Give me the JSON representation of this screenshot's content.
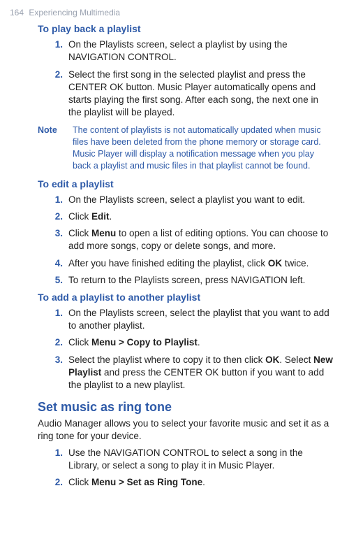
{
  "header": {
    "page": "164",
    "chapter": "Experiencing Multimedia"
  },
  "sec_play": {
    "title": "To play back a playlist",
    "items": [
      {
        "n": "1.",
        "t": "On the Playlists screen, select a playlist by using the NAVIGATION CONTROL."
      },
      {
        "n": "2.",
        "t": "Select the first song in the selected playlist and press the CENTER OK button. Music Player automatically opens and starts playing the first song. After each song, the next one in the playlist will be played."
      }
    ],
    "note_label": "Note",
    "note_body": "The content of playlists is not automatically updated when music files have been deleted from the phone memory or storage card. Music Player will display a notification message when you play back a playlist and music files in that playlist cannot be found."
  },
  "sec_edit": {
    "title": "To edit a playlist",
    "items": [
      {
        "n": "1.",
        "t": "On the Playlists screen, select a playlist you want to edit."
      },
      {
        "n": "2.",
        "pre": "Click ",
        "b1": "Edit",
        "post": "."
      },
      {
        "n": "3.",
        "pre": "Click ",
        "b1": "Menu",
        "post": " to open a list of editing options. You can choose to add more songs, copy or delete songs, and more."
      },
      {
        "n": "4.",
        "pre": "After you have finished editing the playlist, click ",
        "b1": "OK",
        "post": " twice."
      },
      {
        "n": "5.",
        "t": "To return to the Playlists screen, press NAVIGATION left."
      }
    ]
  },
  "sec_add": {
    "title": "To add a playlist to another playlist",
    "items": [
      {
        "n": "1.",
        "t": "On the Playlists screen, select the playlist that you want to add to another playlist."
      },
      {
        "n": "2.",
        "pre": "Click ",
        "b1": "Menu > Copy to Playlist",
        "post": "."
      },
      {
        "n": "3.",
        "pre": "Select the playlist where to copy it to then click ",
        "b1": "OK",
        "mid": ". Select ",
        "b2": "New Playlist",
        "post": " and press the CENTER OK button if you want to add the playlist to a new playlist."
      }
    ]
  },
  "sec_ring": {
    "title": "Set music as ring tone",
    "intro": "Audio Manager allows you to select your favorite music and set it as a ring tone for your device.",
    "items": [
      {
        "n": "1.",
        "t": "Use the NAVIGATION CONTROL to select a song in the Library, or select a song to play it in Music Player."
      },
      {
        "n": "2.",
        "pre": "Click ",
        "b1": "Menu > Set as Ring Tone",
        "post": "."
      }
    ]
  }
}
